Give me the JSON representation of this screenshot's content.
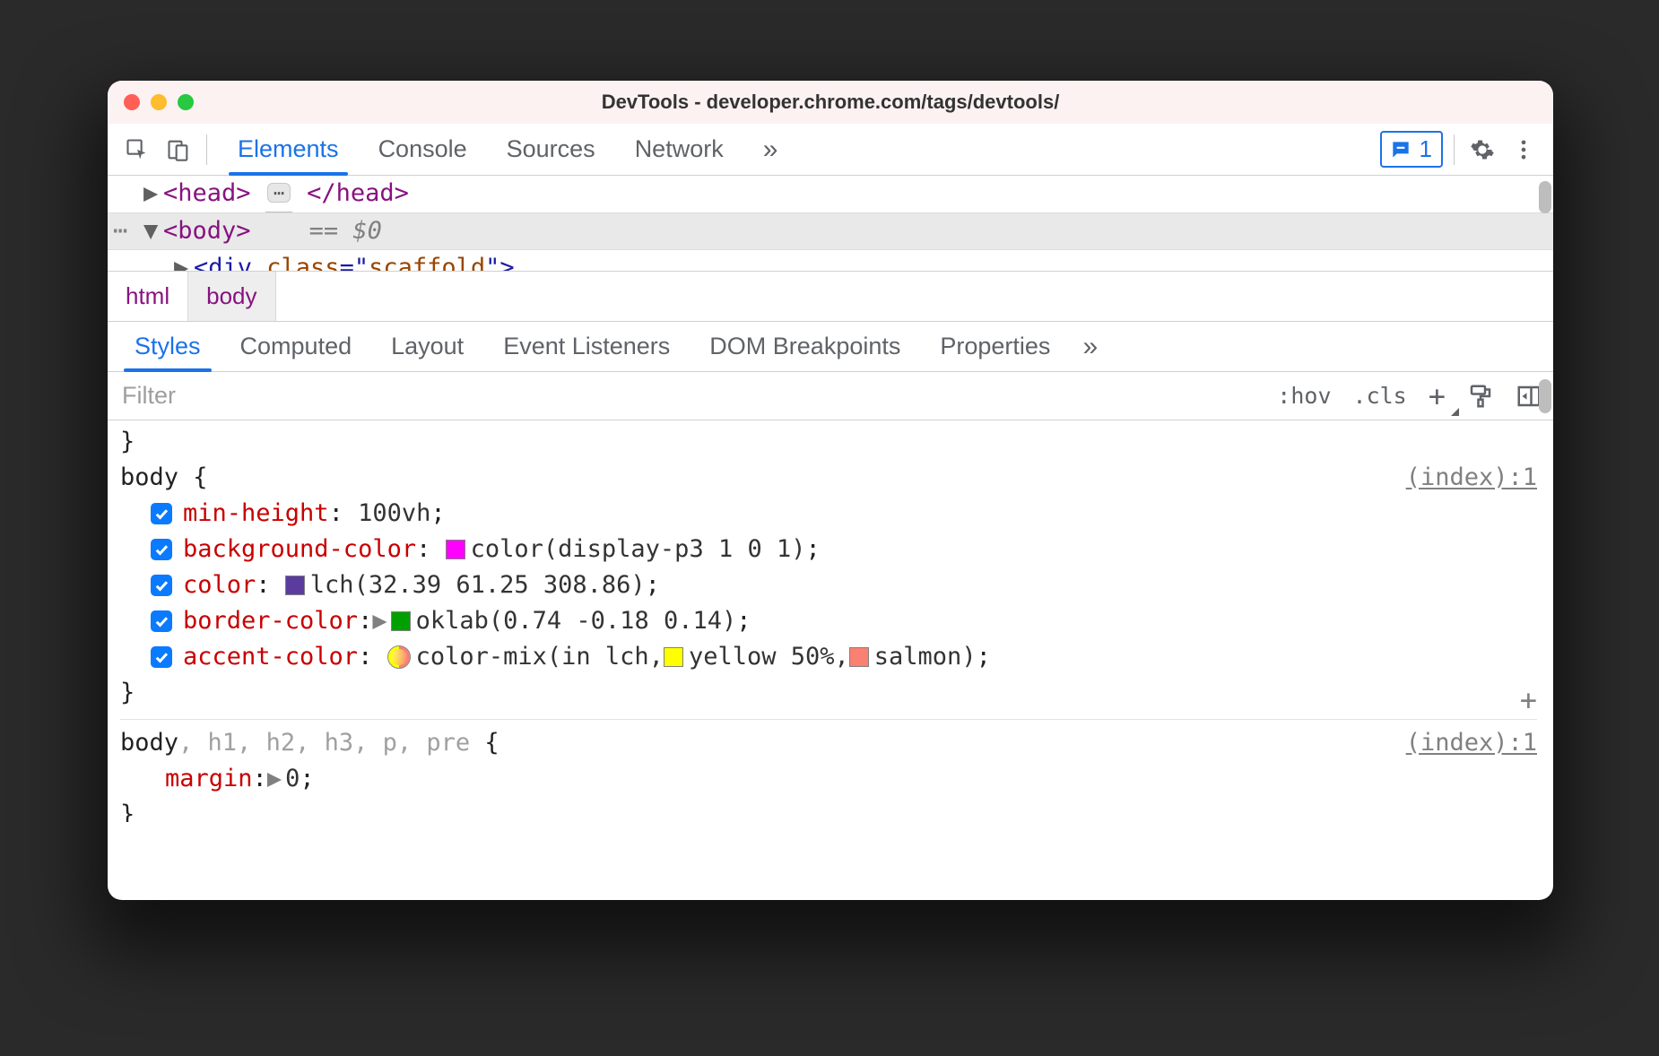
{
  "window": {
    "title": "DevTools - developer.chrome.com/tags/devtools/"
  },
  "toolbar": {
    "tabs": [
      "Elements",
      "Console",
      "Sources",
      "Network"
    ],
    "active_tab": "Elements",
    "more_glyph": "»",
    "issues_count": "1"
  },
  "dom": {
    "head_open": "<head>",
    "head_close": "</head>",
    "body_open": "<body>",
    "eq_dollar": "== $0"
  },
  "breadcrumbs": [
    "html",
    "body"
  ],
  "subtabs": {
    "items": [
      "Styles",
      "Computed",
      "Layout",
      "Event Listeners",
      "DOM Breakpoints",
      "Properties"
    ],
    "active": "Styles",
    "more_glyph": "»"
  },
  "filterbar": {
    "placeholder": "Filter",
    "hov": ":hov",
    "cls": ".cls",
    "plus": "+"
  },
  "rules": {
    "r1": {
      "selector": "body",
      "open_brace": "{",
      "close_brace": "}",
      "source": "(index):1",
      "decls": {
        "d0": {
          "prop": "min-height",
          "value": "100vh"
        },
        "d1": {
          "prop": "background-color",
          "value": "color(display-p3 1 0 1)"
        },
        "d2": {
          "prop": "color",
          "value": "lch(32.39 61.25 308.86)"
        },
        "d3": {
          "prop": "border-color",
          "value": "oklab(0.74 -0.18 0.14)"
        },
        "d4": {
          "prop": "accent-color",
          "value_prefix": "color-mix(in lch, ",
          "seg_yellow": "yellow 50%",
          "comma": ", ",
          "seg_salmon": "salmon",
          "value_suffix": ")"
        }
      },
      "swatches": {
        "bg": "#ff00ff",
        "color": "#5b3b9e",
        "border": "#00a000",
        "yellow": "#ffff00",
        "salmon": "#fa8072"
      }
    },
    "r2": {
      "selector_matched": "body",
      "selector_unmatched": ", h1, h2, h3, p, pre",
      "open_brace": " {",
      "close_brace": "}",
      "source": "(index):1",
      "decl": {
        "prop": "margin",
        "value": "0"
      }
    }
  }
}
